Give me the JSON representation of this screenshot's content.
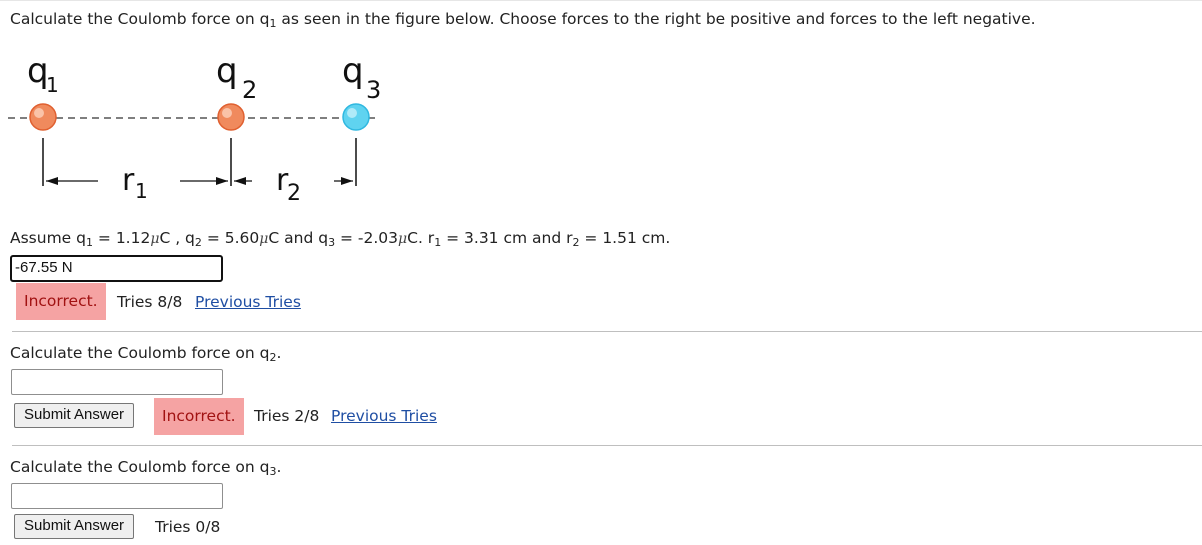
{
  "problem": {
    "prompt_main": "Calculate the Coulomb force on q",
    "prompt_sub": "1",
    "prompt_rest": " as seen in the figure below. Choose forces to the right be positive and forces to the left negative."
  },
  "figure": {
    "charges": [
      {
        "name": "q",
        "sub": "1",
        "color": "#f08a5d"
      },
      {
        "name": "q",
        "sub": "2",
        "color": "#f08a5d"
      },
      {
        "name": "q",
        "sub": "3",
        "color": "#5fd3f0"
      }
    ],
    "distances": [
      {
        "name": "r",
        "sub": "1"
      },
      {
        "name": "r",
        "sub": "2"
      }
    ]
  },
  "assume": {
    "t1": "Assume q",
    "s1": "1",
    "t2": " = 1.12",
    "u1": "μ",
    "t3": "C , q",
    "s2": "2",
    "t4": " = 5.60",
    "u2": "μ",
    "t5": "C and q",
    "s3": "3",
    "t6": " = -2.03",
    "u3": "μ",
    "t7": "C. r",
    "s4": "1",
    "t8": " = 3.31 cm and r",
    "s5": "2",
    "t9": " = 1.51 cm."
  },
  "part1": {
    "answer_value": "-67.55 N",
    "status": "Incorrect.",
    "tries": "Tries 8/8",
    "previous": "Previous Tries"
  },
  "part2": {
    "prompt": "Calculate the Coulomb force on q",
    "sub": "2",
    "end": ".",
    "answer_value": "",
    "submit": "Submit Answer",
    "status": "Incorrect.",
    "tries": "Tries 2/8",
    "previous": "Previous Tries"
  },
  "part3": {
    "prompt": "Calculate the Coulomb force on q",
    "sub": "3",
    "end": ".",
    "answer_value": "",
    "submit": "Submit Answer",
    "tries": "Tries 0/8"
  }
}
